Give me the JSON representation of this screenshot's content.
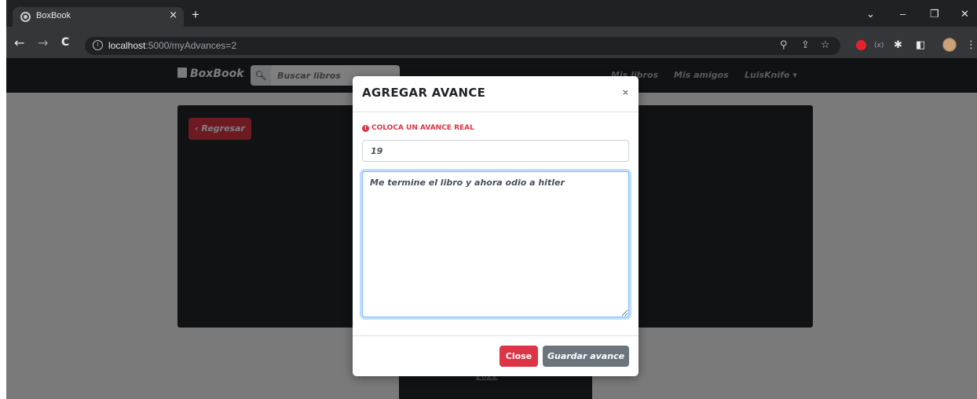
{
  "browser": {
    "tab_title": "BoxBook",
    "tab_close": "×",
    "new_tab": "+",
    "url_host": "localhost",
    "url_rest": ":5000/myAdvances=2",
    "back": "←",
    "forward": "→",
    "reload": "C",
    "window_controls": {
      "tabsearch": "⌄",
      "minimize": "–",
      "restore": "❐",
      "close": "✕"
    }
  },
  "navbar": {
    "brand": "BoxBook",
    "search_placeholder": "Buscar libros",
    "links": {
      "my_books": "Mis libros",
      "my_friends": "Mis amigos",
      "user": "LuisKnife ▾"
    }
  },
  "page": {
    "back_button": "‹ Regresar",
    "footer_text": "2022"
  },
  "modal": {
    "title": "AGREGAR AVANCE",
    "close_symbol": "×",
    "alert": "COLOCA UN AVANCE REAL",
    "progress_value": "19",
    "comment_value": "Me termine el libro y ahora odio a hitler",
    "close_button": "Close",
    "save_button": "Guardar avance"
  },
  "colors": {
    "danger": "#dc3545",
    "secondary": "#6c757d",
    "navbar_bg": "#212529",
    "focus_border": "#80bdff"
  }
}
